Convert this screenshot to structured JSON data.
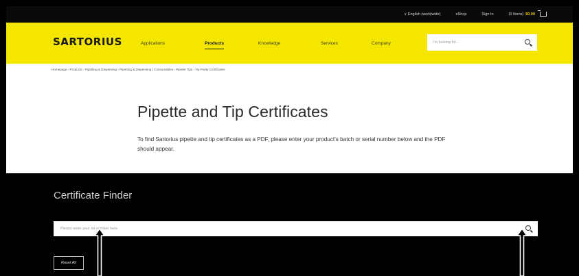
{
  "utility_bar": {
    "language": "∨ English (worldwide)",
    "eshop": "eShop",
    "sign_in": "Sign In",
    "cart_prefix": "(0 Items)",
    "cart_total": "$0.00",
    "icons": [
      "chevron-down-icon",
      "cart-icon"
    ]
  },
  "header": {
    "logo": "SARTORIUS",
    "nav": [
      {
        "label": "Applications",
        "active": false
      },
      {
        "label": "Products",
        "active": true
      },
      {
        "label": "Knowledge",
        "active": false
      },
      {
        "label": "Services",
        "active": false
      },
      {
        "label": "Company",
        "active": false
      }
    ],
    "search_placeholder": "I'm looking for...",
    "accent_color": "#f5e600"
  },
  "content": {
    "breadcrumb": "Homepage › Products › Pipetting & Dispensing › Pipetting & Dispensing | Consumables › Pipette Tips › Tip Purity Certificates",
    "title": "Pipette and Tip Certificates",
    "description": "To find Sartorius pipette and tip certificates as a PDF, please enter your product's batch or serial number below and the PDF should appear."
  },
  "finder": {
    "title": "Certificate Finder",
    "input_placeholder": "Please enter your lot number here",
    "input_value": "",
    "reset_label": "Reset All"
  }
}
